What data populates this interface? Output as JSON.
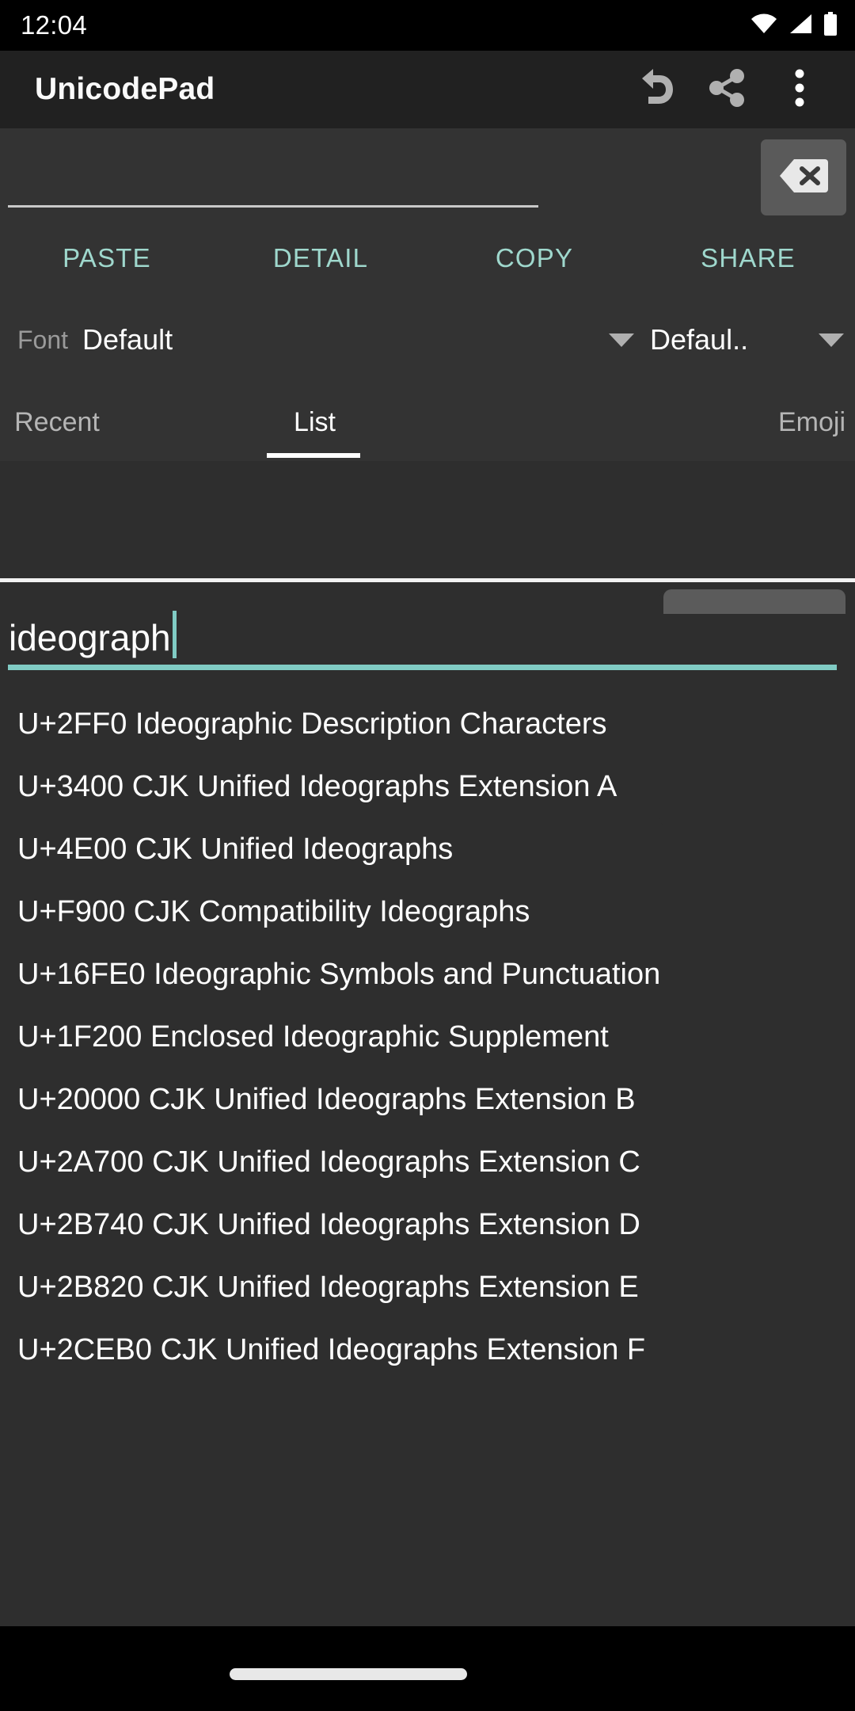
{
  "status_bar": {
    "clock": "12:04",
    "icons": [
      "wifi-icon",
      "cell-signal-icon",
      "battery-icon"
    ]
  },
  "app_bar": {
    "title": "UnicodePad",
    "actions": [
      {
        "name": "undo-icon",
        "label": "Undo"
      },
      {
        "name": "share-icon",
        "label": "Share"
      },
      {
        "name": "overflow-menu-icon",
        "label": "More options"
      }
    ]
  },
  "editor": {
    "value": "",
    "placeholder": "",
    "backspace_label": "Backspace",
    "backspace_icon": "backspace-icon"
  },
  "actions": {
    "paste": "PASTE",
    "detail": "DETAIL",
    "copy": "COPY",
    "share": "SHARE"
  },
  "font_row": {
    "label": "Font",
    "family_value": "Default",
    "style_value": "Defaul.."
  },
  "tabs": {
    "items": [
      {
        "label": "Recent",
        "selected": false
      },
      {
        "label": "List",
        "selected": true
      },
      {
        "label": "Emoji",
        "selected": false
      }
    ]
  },
  "search": {
    "value": "ideograph",
    "placeholder": "Search"
  },
  "list": {
    "items": [
      {
        "code": "U+2FF0",
        "name": "Ideographic Description Characters",
        "text": "U+2FF0 Ideographic Description Characters"
      },
      {
        "code": "U+3400",
        "name": "CJK Unified Ideographs Extension A",
        "text": "U+3400 CJK Unified Ideographs Extension A"
      },
      {
        "code": "U+4E00",
        "name": "CJK Unified Ideographs",
        "text": "U+4E00 CJK Unified Ideographs"
      },
      {
        "code": "U+F900",
        "name": "CJK Compatibility Ideographs",
        "text": "U+F900 CJK Compatibility Ideographs"
      },
      {
        "code": "U+16FE0",
        "name": "Ideographic Symbols and Punctuation",
        "text": "U+16FE0 Ideographic Symbols and Punctuation"
      },
      {
        "code": "U+1F200",
        "name": "Enclosed Ideographic Supplement",
        "text": "U+1F200 Enclosed Ideographic Supplement"
      },
      {
        "code": "U+20000",
        "name": "CJK Unified Ideographs Extension B",
        "text": "U+20000 CJK Unified Ideographs Extension B"
      },
      {
        "code": "U+2A700",
        "name": "CJK Unified Ideographs Extension C",
        "text": "U+2A700 CJK Unified Ideographs Extension C"
      },
      {
        "code": "U+2B740",
        "name": "CJK Unified Ideographs Extension D",
        "text": "U+2B740 CJK Unified Ideographs Extension D"
      },
      {
        "code": "U+2B820",
        "name": "CJK Unified Ideographs Extension E",
        "text": "U+2B820 CJK Unified Ideographs Extension E"
      },
      {
        "code": "U+2CEB0",
        "name": "CJK Unified Ideographs Extension F",
        "text": "U+2CEB0 CJK Unified Ideographs Extension F"
      }
    ]
  },
  "nav_bar": {
    "home_indicator": "home-indicator"
  },
  "colors": {
    "accent": "#80cbc4",
    "action_text": "#9fd8cd",
    "app_bar_bg": "#212121",
    "panel_bg": "#333333",
    "content_bg": "#2e2e2e",
    "status_bg": "#000000",
    "text_primary": "#ffffff",
    "text_secondary": "#9a9a9a"
  }
}
